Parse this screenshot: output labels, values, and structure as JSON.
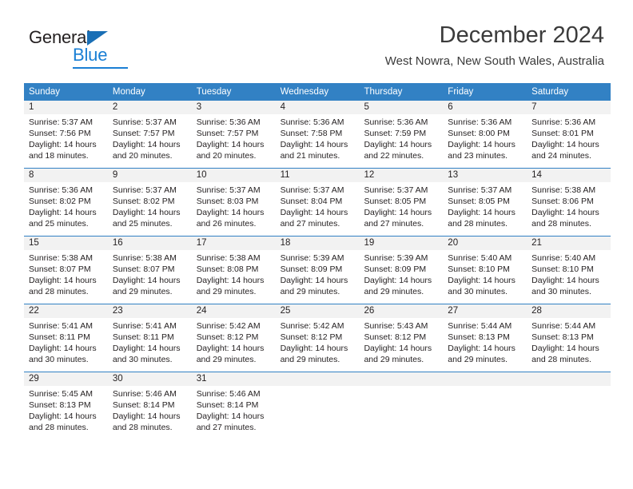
{
  "logo": {
    "word_one": "General",
    "word_two": "Blue",
    "triangle_color": "#1a6fb5",
    "blue_color": "#1a7fd4"
  },
  "header": {
    "title": "December 2024",
    "subtitle": "West Nowra, New South Wales, Australia"
  },
  "theme": {
    "header_blue": "#3281c4",
    "daynum_band": "#f2f2f2",
    "text": "#231f20"
  },
  "weekdays": [
    "Sunday",
    "Monday",
    "Tuesday",
    "Wednesday",
    "Thursday",
    "Friday",
    "Saturday"
  ],
  "weeks": [
    [
      {
        "day": "1",
        "sunrise": "Sunrise: 5:37 AM",
        "sunset": "Sunset: 7:56 PM",
        "daylight_1": "Daylight: 14 hours",
        "daylight_2": "and 18 minutes."
      },
      {
        "day": "2",
        "sunrise": "Sunrise: 5:37 AM",
        "sunset": "Sunset: 7:57 PM",
        "daylight_1": "Daylight: 14 hours",
        "daylight_2": "and 20 minutes."
      },
      {
        "day": "3",
        "sunrise": "Sunrise: 5:36 AM",
        "sunset": "Sunset: 7:57 PM",
        "daylight_1": "Daylight: 14 hours",
        "daylight_2": "and 20 minutes."
      },
      {
        "day": "4",
        "sunrise": "Sunrise: 5:36 AM",
        "sunset": "Sunset: 7:58 PM",
        "daylight_1": "Daylight: 14 hours",
        "daylight_2": "and 21 minutes."
      },
      {
        "day": "5",
        "sunrise": "Sunrise: 5:36 AM",
        "sunset": "Sunset: 7:59 PM",
        "daylight_1": "Daylight: 14 hours",
        "daylight_2": "and 22 minutes."
      },
      {
        "day": "6",
        "sunrise": "Sunrise: 5:36 AM",
        "sunset": "Sunset: 8:00 PM",
        "daylight_1": "Daylight: 14 hours",
        "daylight_2": "and 23 minutes."
      },
      {
        "day": "7",
        "sunrise": "Sunrise: 5:36 AM",
        "sunset": "Sunset: 8:01 PM",
        "daylight_1": "Daylight: 14 hours",
        "daylight_2": "and 24 minutes."
      }
    ],
    [
      {
        "day": "8",
        "sunrise": "Sunrise: 5:36 AM",
        "sunset": "Sunset: 8:02 PM",
        "daylight_1": "Daylight: 14 hours",
        "daylight_2": "and 25 minutes."
      },
      {
        "day": "9",
        "sunrise": "Sunrise: 5:37 AM",
        "sunset": "Sunset: 8:02 PM",
        "daylight_1": "Daylight: 14 hours",
        "daylight_2": "and 25 minutes."
      },
      {
        "day": "10",
        "sunrise": "Sunrise: 5:37 AM",
        "sunset": "Sunset: 8:03 PM",
        "daylight_1": "Daylight: 14 hours",
        "daylight_2": "and 26 minutes."
      },
      {
        "day": "11",
        "sunrise": "Sunrise: 5:37 AM",
        "sunset": "Sunset: 8:04 PM",
        "daylight_1": "Daylight: 14 hours",
        "daylight_2": "and 27 minutes."
      },
      {
        "day": "12",
        "sunrise": "Sunrise: 5:37 AM",
        "sunset": "Sunset: 8:05 PM",
        "daylight_1": "Daylight: 14 hours",
        "daylight_2": "and 27 minutes."
      },
      {
        "day": "13",
        "sunrise": "Sunrise: 5:37 AM",
        "sunset": "Sunset: 8:05 PM",
        "daylight_1": "Daylight: 14 hours",
        "daylight_2": "and 28 minutes."
      },
      {
        "day": "14",
        "sunrise": "Sunrise: 5:38 AM",
        "sunset": "Sunset: 8:06 PM",
        "daylight_1": "Daylight: 14 hours",
        "daylight_2": "and 28 minutes."
      }
    ],
    [
      {
        "day": "15",
        "sunrise": "Sunrise: 5:38 AM",
        "sunset": "Sunset: 8:07 PM",
        "daylight_1": "Daylight: 14 hours",
        "daylight_2": "and 28 minutes."
      },
      {
        "day": "16",
        "sunrise": "Sunrise: 5:38 AM",
        "sunset": "Sunset: 8:07 PM",
        "daylight_1": "Daylight: 14 hours",
        "daylight_2": "and 29 minutes."
      },
      {
        "day": "17",
        "sunrise": "Sunrise: 5:38 AM",
        "sunset": "Sunset: 8:08 PM",
        "daylight_1": "Daylight: 14 hours",
        "daylight_2": "and 29 minutes."
      },
      {
        "day": "18",
        "sunrise": "Sunrise: 5:39 AM",
        "sunset": "Sunset: 8:09 PM",
        "daylight_1": "Daylight: 14 hours",
        "daylight_2": "and 29 minutes."
      },
      {
        "day": "19",
        "sunrise": "Sunrise: 5:39 AM",
        "sunset": "Sunset: 8:09 PM",
        "daylight_1": "Daylight: 14 hours",
        "daylight_2": "and 29 minutes."
      },
      {
        "day": "20",
        "sunrise": "Sunrise: 5:40 AM",
        "sunset": "Sunset: 8:10 PM",
        "daylight_1": "Daylight: 14 hours",
        "daylight_2": "and 30 minutes."
      },
      {
        "day": "21",
        "sunrise": "Sunrise: 5:40 AM",
        "sunset": "Sunset: 8:10 PM",
        "daylight_1": "Daylight: 14 hours",
        "daylight_2": "and 30 minutes."
      }
    ],
    [
      {
        "day": "22",
        "sunrise": "Sunrise: 5:41 AM",
        "sunset": "Sunset: 8:11 PM",
        "daylight_1": "Daylight: 14 hours",
        "daylight_2": "and 30 minutes."
      },
      {
        "day": "23",
        "sunrise": "Sunrise: 5:41 AM",
        "sunset": "Sunset: 8:11 PM",
        "daylight_1": "Daylight: 14 hours",
        "daylight_2": "and 30 minutes."
      },
      {
        "day": "24",
        "sunrise": "Sunrise: 5:42 AM",
        "sunset": "Sunset: 8:12 PM",
        "daylight_1": "Daylight: 14 hours",
        "daylight_2": "and 29 minutes."
      },
      {
        "day": "25",
        "sunrise": "Sunrise: 5:42 AM",
        "sunset": "Sunset: 8:12 PM",
        "daylight_1": "Daylight: 14 hours",
        "daylight_2": "and 29 minutes."
      },
      {
        "day": "26",
        "sunrise": "Sunrise: 5:43 AM",
        "sunset": "Sunset: 8:12 PM",
        "daylight_1": "Daylight: 14 hours",
        "daylight_2": "and 29 minutes."
      },
      {
        "day": "27",
        "sunrise": "Sunrise: 5:44 AM",
        "sunset": "Sunset: 8:13 PM",
        "daylight_1": "Daylight: 14 hours",
        "daylight_2": "and 29 minutes."
      },
      {
        "day": "28",
        "sunrise": "Sunrise: 5:44 AM",
        "sunset": "Sunset: 8:13 PM",
        "daylight_1": "Daylight: 14 hours",
        "daylight_2": "and 28 minutes."
      }
    ],
    [
      {
        "day": "29",
        "sunrise": "Sunrise: 5:45 AM",
        "sunset": "Sunset: 8:13 PM",
        "daylight_1": "Daylight: 14 hours",
        "daylight_2": "and 28 minutes."
      },
      {
        "day": "30",
        "sunrise": "Sunrise: 5:46 AM",
        "sunset": "Sunset: 8:14 PM",
        "daylight_1": "Daylight: 14 hours",
        "daylight_2": "and 28 minutes."
      },
      {
        "day": "31",
        "sunrise": "Sunrise: 5:46 AM",
        "sunset": "Sunset: 8:14 PM",
        "daylight_1": "Daylight: 14 hours",
        "daylight_2": "and 27 minutes."
      },
      {
        "day": "",
        "sunrise": "",
        "sunset": "",
        "daylight_1": "",
        "daylight_2": ""
      },
      {
        "day": "",
        "sunrise": "",
        "sunset": "",
        "daylight_1": "",
        "daylight_2": ""
      },
      {
        "day": "",
        "sunrise": "",
        "sunset": "",
        "daylight_1": "",
        "daylight_2": ""
      },
      {
        "day": "",
        "sunrise": "",
        "sunset": "",
        "daylight_1": "",
        "daylight_2": ""
      }
    ]
  ]
}
